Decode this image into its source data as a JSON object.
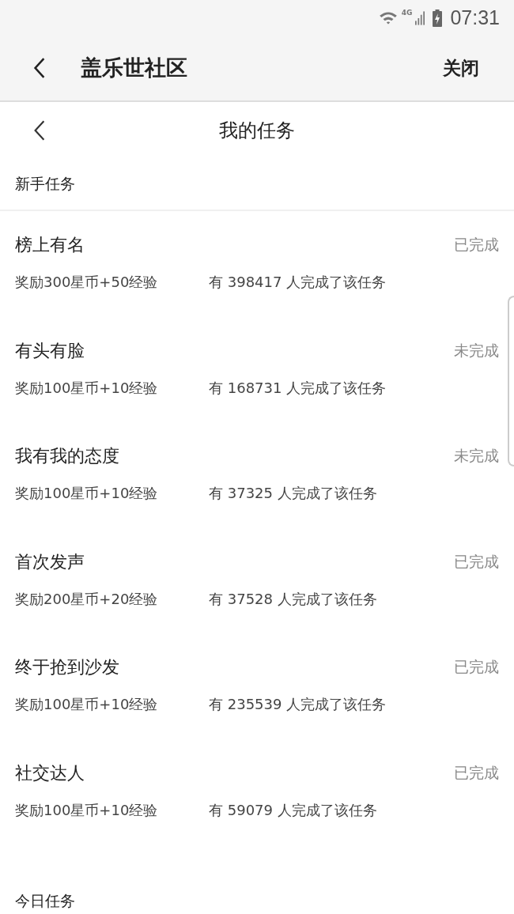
{
  "status_bar": {
    "time": "07:31",
    "network": "4G"
  },
  "app_bar": {
    "title": "盖乐世社区",
    "close": "关闭"
  },
  "page": {
    "title": "我的任务"
  },
  "sections": [
    {
      "title": "新手任务",
      "tasks": [
        {
          "name": "榜上有名",
          "status": "已完成",
          "reward": "奖励300星币+50经验",
          "count": "有 398417 人完成了该任务"
        },
        {
          "name": "有头有脸",
          "status": "未完成",
          "reward": "奖励100星币+10经验",
          "count": "有 168731 人完成了该任务"
        },
        {
          "name": "我有我的态度",
          "status": "未完成",
          "reward": "奖励100星币+10经验",
          "count": "有 37325 人完成了该任务"
        },
        {
          "name": "首次发声",
          "status": "已完成",
          "reward": "奖励200星币+20经验",
          "count": "有 37528 人完成了该任务"
        },
        {
          "name": "终于抢到沙发",
          "status": "已完成",
          "reward": "奖励100星币+10经验",
          "count": "有 235539 人完成了该任务"
        },
        {
          "name": "社交达人",
          "status": "已完成",
          "reward": "奖励100星币+10经验",
          "count": "有 59079 人完成了该任务"
        }
      ]
    },
    {
      "title": "今日任务"
    }
  ]
}
